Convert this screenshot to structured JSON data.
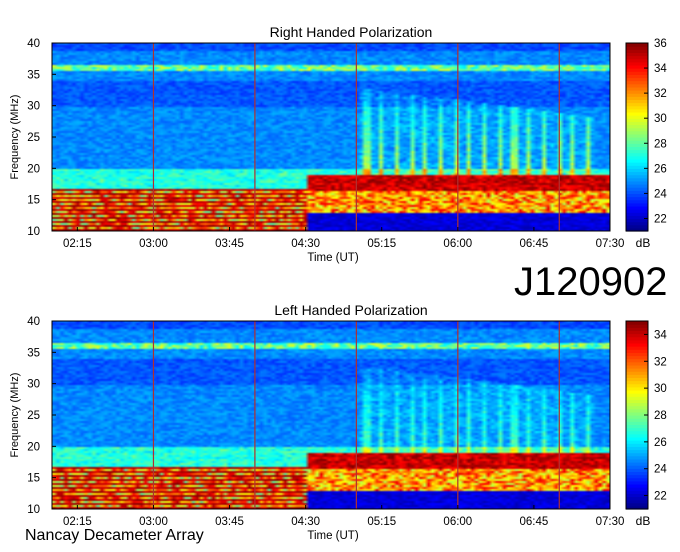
{
  "figure_id": "J120902",
  "instrument_label": "Nancay Decameter Array",
  "chart_data": [
    {
      "type": "heatmap",
      "title": "Right Handed Polarization",
      "xlabel": "Time (UT)",
      "ylabel": "Frequency (MHz)",
      "x_range": [
        "02:00",
        "07:30"
      ],
      "ylim": [
        10,
        40
      ],
      "x_ticks": [
        "02:15",
        "03:00",
        "03:45",
        "04:30",
        "05:15",
        "06:00",
        "06:45",
        "07:30"
      ],
      "y_ticks": [
        10,
        15,
        20,
        25,
        30,
        35,
        40
      ],
      "colorbar": {
        "label": "dB",
        "min": 21,
        "max": 36,
        "ticks": [
          22,
          24,
          26,
          28,
          30,
          32,
          34,
          36
        ]
      },
      "time_markers": [
        "03:00",
        "04:00",
        "05:00",
        "06:00",
        "07:00"
      ]
    },
    {
      "type": "heatmap",
      "title": "Left Handed Polarization",
      "xlabel": "Time (UT)",
      "ylabel": "Frequency (MHz)",
      "x_range": [
        "02:00",
        "07:30"
      ],
      "ylim": [
        10,
        40
      ],
      "x_ticks": [
        "02:15",
        "03:00",
        "03:45",
        "04:30",
        "05:15",
        "06:00",
        "06:45",
        "07:30"
      ],
      "y_ticks": [
        10,
        15,
        20,
        25,
        30,
        35,
        40
      ],
      "colorbar": {
        "label": "dB",
        "min": 21,
        "max": 35,
        "ticks": [
          22,
          24,
          26,
          28,
          30,
          32,
          34
        ]
      },
      "time_markers": [
        "03:00",
        "04:00",
        "05:00",
        "06:00",
        "07:00"
      ]
    }
  ]
}
